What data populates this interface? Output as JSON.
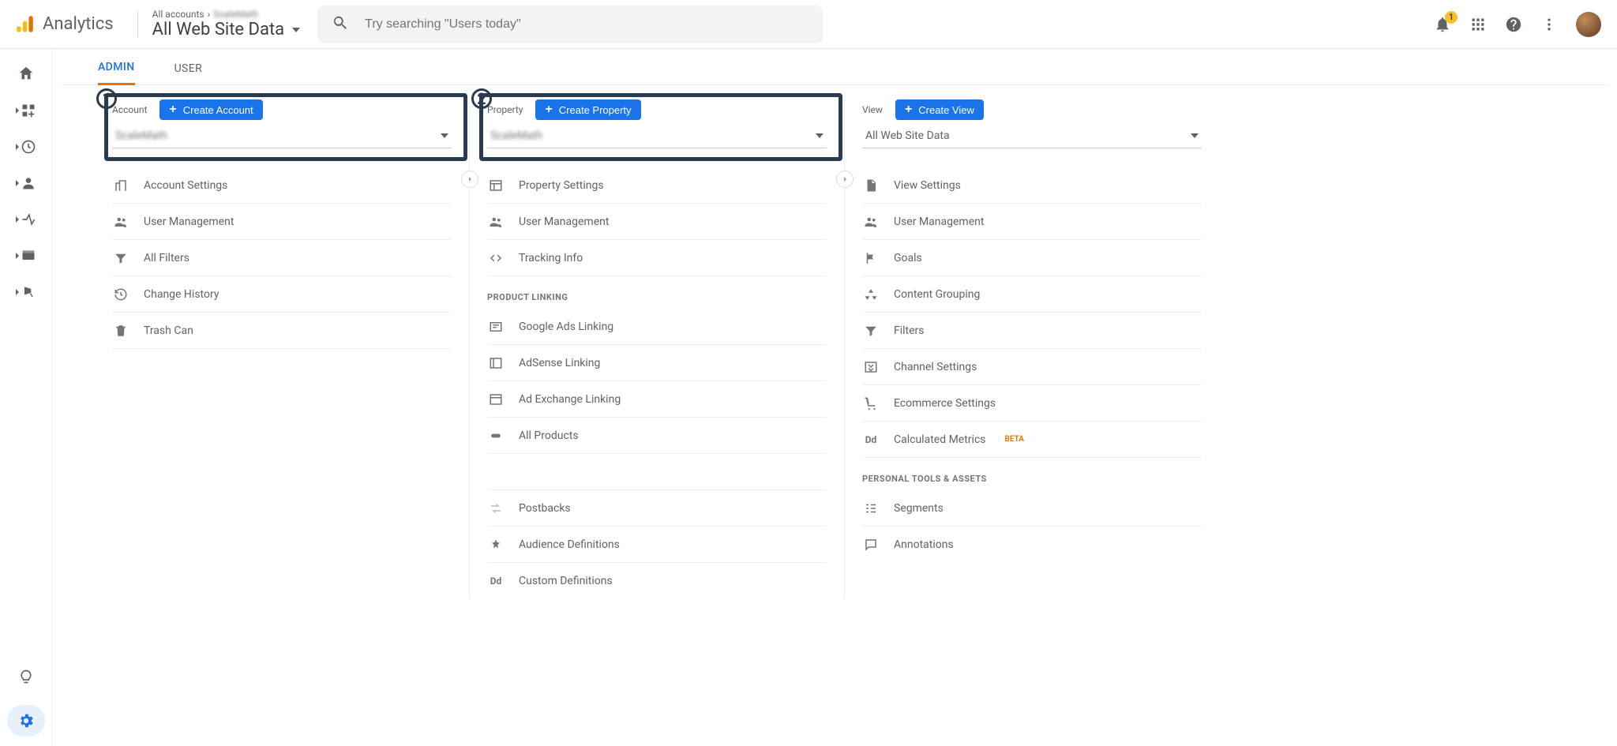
{
  "header": {
    "product": "Analytics",
    "breadcrumb_prefix": "All accounts",
    "breadcrumb_sep": "›",
    "breadcrumb_account": "ScaleMath",
    "scope_title": "All Web Site Data",
    "search_placeholder": "Try searching \"Users today\"",
    "notifications_count": "1"
  },
  "tabs": {
    "admin": "ADMIN",
    "user": "USER"
  },
  "account_col": {
    "label": "Account",
    "create": "Create Account",
    "selected": "ScaleMath",
    "items": [
      "Account Settings",
      "User Management",
      "All Filters",
      "Change History",
      "Trash Can"
    ]
  },
  "property_col": {
    "label": "Property",
    "create": "Create Property",
    "selected": "ScaleMath",
    "items_top": [
      "Property Settings",
      "User Management",
      "Tracking Info"
    ],
    "section_link": "PRODUCT LINKING",
    "items_link": [
      "Google Ads Linking",
      "AdSense Linking",
      "Ad Exchange Linking",
      "All Products"
    ],
    "items_bottom": [
      "Postbacks",
      "Audience Definitions",
      "Custom Definitions"
    ]
  },
  "view_col": {
    "label": "View",
    "create": "Create View",
    "selected": "All Web Site Data",
    "items_top": [
      "View Settings",
      "User Management",
      "Goals",
      "Content Grouping",
      "Filters",
      "Channel Settings",
      "Ecommerce Settings"
    ],
    "calculated": "Calculated Metrics",
    "beta": "BETA",
    "section_pt": "PERSONAL TOOLS & ASSETS",
    "items_pt": [
      "Segments",
      "Annotations"
    ]
  },
  "annotations": {
    "one": "1",
    "two": "2"
  }
}
